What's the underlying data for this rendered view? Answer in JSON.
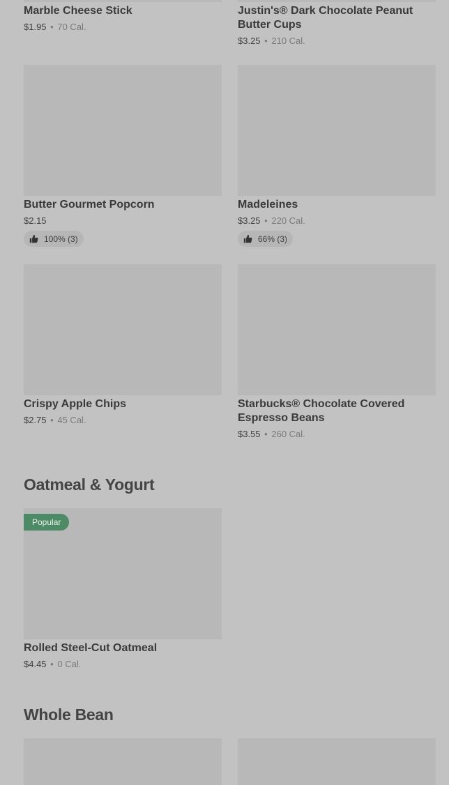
{
  "products": [
    {
      "name": "Marble Cheese Stick",
      "price": "$1.95",
      "calories": "70 Cal."
    },
    {
      "name": "Justin's® Dark Chocolate Peanut Butter Cups",
      "price": "$3.25",
      "calories": "210 Cal."
    },
    {
      "name": "Butter Gourmet Popcorn",
      "price": "$2.15",
      "rating": "100% (3)"
    },
    {
      "name": "Madeleines",
      "price": "$3.25",
      "calories": "220 Cal.",
      "rating": "66% (3)"
    },
    {
      "name": "Crispy Apple Chips",
      "price": "$2.75",
      "calories": "45 Cal."
    },
    {
      "name": "Starbucks® Chocolate Covered Espresso Beans",
      "price": "$3.55",
      "calories": "260 Cal."
    },
    {
      "name": "Rolled Steel-Cut Oatmeal",
      "price": "$4.45",
      "calories": "0 Cal.",
      "badge": "Popular"
    }
  ],
  "sections": {
    "oatmeal": "Oatmeal & Yogurt",
    "whole_bean": "Whole Bean"
  },
  "separator": "•",
  "icons": {
    "rating": "thumbs-up-icon"
  },
  "colors": {
    "badge": "#4d8a66",
    "background": "#c2c2c2"
  }
}
